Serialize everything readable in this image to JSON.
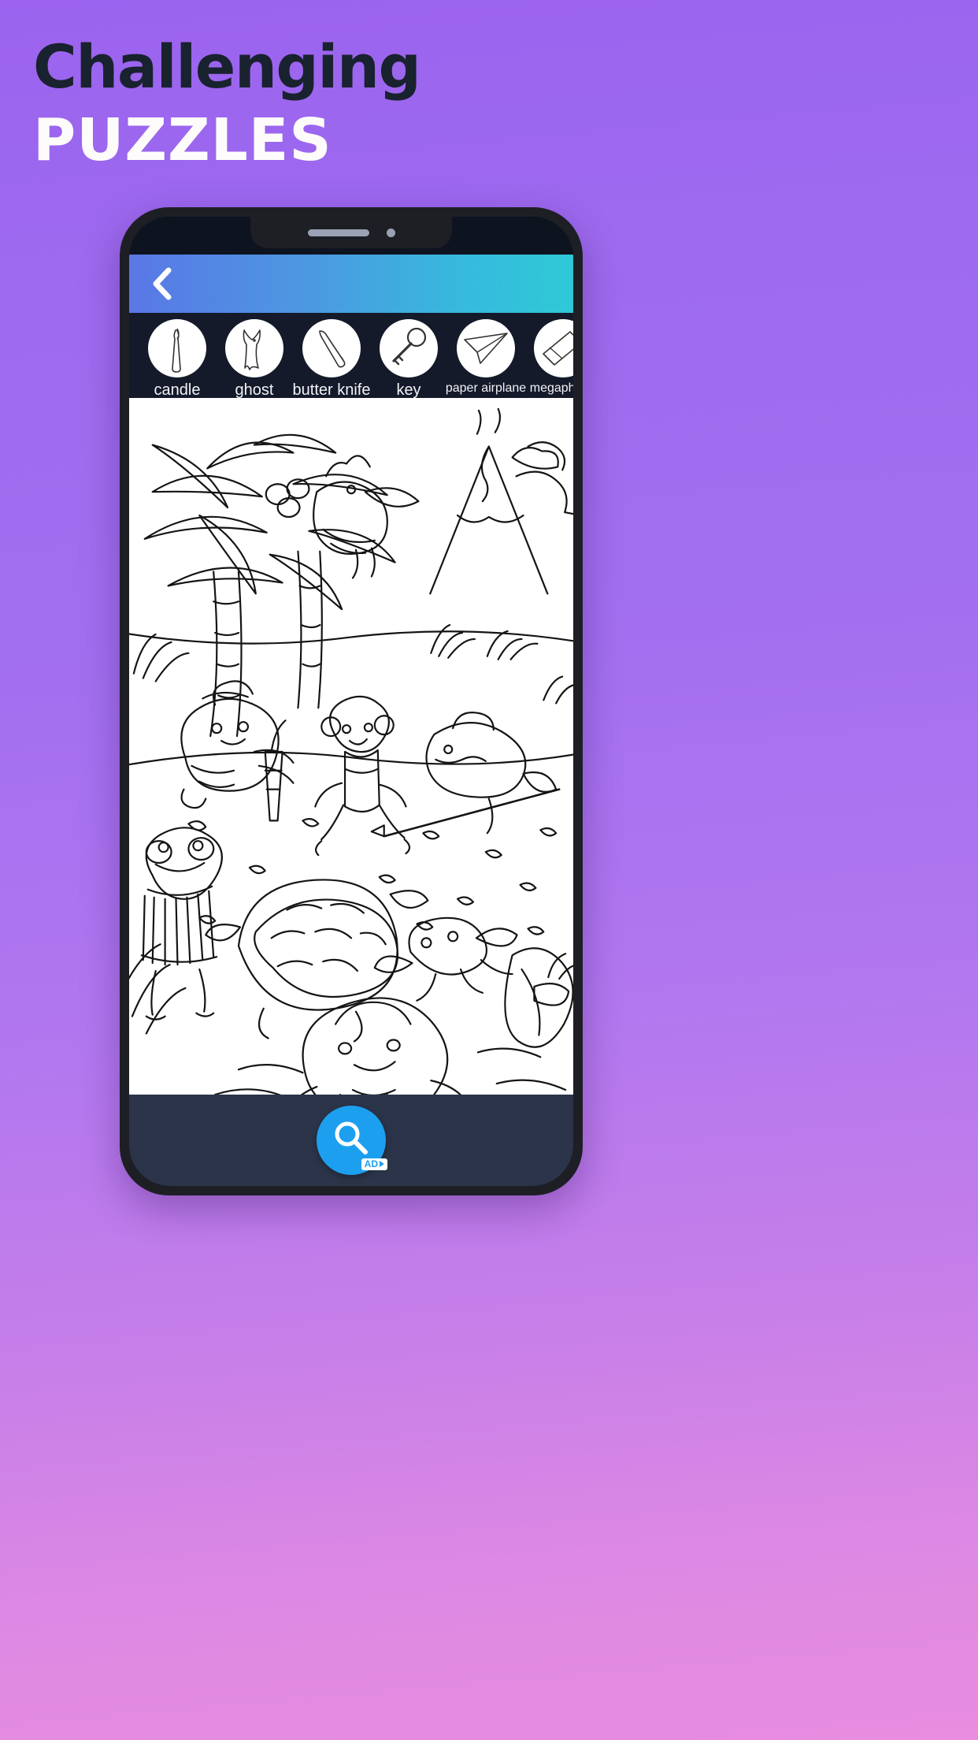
{
  "promo": {
    "headline_line1": "Challenging",
    "headline_line2": "PUZZLES",
    "headline_line1_color": "#19222f",
    "headline_line2_color": "#fdfcfb",
    "background_colors": [
      "#9b63ef",
      "#b277ef",
      "#e88ddf"
    ]
  },
  "app": {
    "header": {
      "back_label": "‹",
      "gradient_from": "#5a77e6",
      "gradient_to": "#2ec9d6"
    },
    "word_bar": {
      "background": "#141a2a",
      "items": [
        {
          "label": "candle",
          "icon": "candle-icon"
        },
        {
          "label": "ghost",
          "icon": "ghost-icon"
        },
        {
          "label": "butter knife",
          "icon": "butter-knife-icon"
        },
        {
          "label": "key",
          "icon": "key-icon"
        },
        {
          "label": "paper airplane",
          "icon": "paper-airplane-icon"
        },
        {
          "label": "megaphone",
          "icon": "megaphone-icon"
        }
      ]
    },
    "puzzle_scene": {
      "description": "Tropical beach hidden-object line drawing with toucan, palm trees, volcano, turtle, monkey, crab, frog, shark and octopus",
      "line_color": "#111111",
      "background": "#ffffff"
    },
    "bottom_bar": {
      "background": "#2b3449",
      "hint_button": {
        "icon": "magnifier-icon",
        "color": "#1d9ff0",
        "ad_label": "AD"
      }
    }
  }
}
